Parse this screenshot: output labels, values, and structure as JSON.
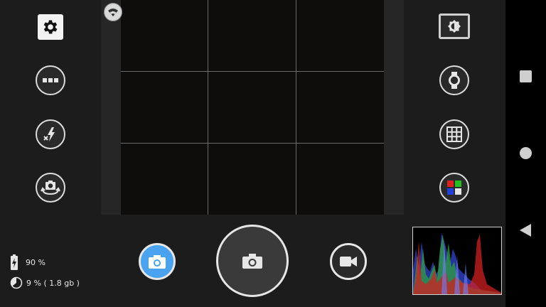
{
  "status": {
    "battery_text": "90 %",
    "storage_text": "9 % ( 1.8 gb )"
  },
  "icons": {
    "settings": "gear-icon",
    "more": "more-dots-icon",
    "flash": "flash-off-icon",
    "switch_camera": "switch-camera-icon",
    "exposure": "exposure-icon",
    "white_balance": "watch-icon",
    "grid": "grid-icon",
    "color_effect": "color-effect-icon",
    "wifi": "wifi-icon"
  },
  "colors": {
    "accent": "#4aa3f0"
  },
  "modes": {
    "photo": "photo-mode",
    "video": "video-mode"
  }
}
